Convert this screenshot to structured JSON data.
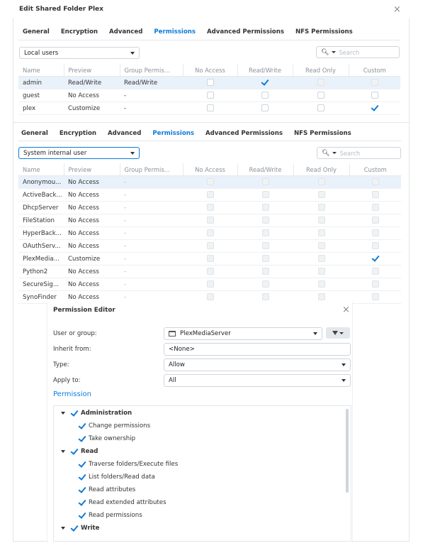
{
  "dialog_title": "Edit Shared Folder Plex",
  "tabs": [
    "General",
    "Encryption",
    "Advanced",
    "Permissions",
    "Advanced Permissions",
    "NFS Permissions"
  ],
  "panel1": {
    "user_filter": "Local users",
    "search_placeholder": "Search",
    "columns": [
      "Name",
      "Preview",
      "Group Permis...",
      "No Access",
      "Read/Write",
      "Read Only",
      "Custom"
    ],
    "rows": [
      {
        "name": "admin",
        "preview": "Read/Write",
        "group": "Read/Write"
      },
      {
        "name": "guest",
        "preview": "No Access",
        "group": "-"
      },
      {
        "name": "plex",
        "preview": "Customize",
        "group": "-"
      }
    ]
  },
  "panel2": {
    "user_filter": "System internal user",
    "search_placeholder": "Search",
    "columns": [
      "Name",
      "Preview",
      "Group Permis...",
      "No Access",
      "Read/Write",
      "Read Only",
      "Custom"
    ],
    "rows": [
      {
        "name": "Anonymou...",
        "preview": "No Access",
        "group": "-"
      },
      {
        "name": "ActiveBack...",
        "preview": "No Access",
        "group": "-"
      },
      {
        "name": "DhcpServer",
        "preview": "No Access",
        "group": "-"
      },
      {
        "name": "FileStation",
        "preview": "No Access",
        "group": "-"
      },
      {
        "name": "HyperBack...",
        "preview": "No Access",
        "group": "-"
      },
      {
        "name": "OAuthServ...",
        "preview": "No Access",
        "group": "-"
      },
      {
        "name": "PlexMedia...",
        "preview": "Customize",
        "group": "-"
      },
      {
        "name": "Python2",
        "preview": "No Access",
        "group": "-"
      },
      {
        "name": "SecureSig...",
        "preview": "No Access",
        "group": "-"
      },
      {
        "name": "SynoFinder",
        "preview": "No Access",
        "group": "-"
      }
    ]
  },
  "editor": {
    "title": "Permission Editor",
    "user_label": "User or group:",
    "user_value": "PlexMediaServer",
    "inherit_label": "Inherit from:",
    "inherit_value": "<None>",
    "type_label": "Type:",
    "type_value": "Allow",
    "apply_label": "Apply to:",
    "apply_value": "All",
    "permission_heading": "Permission",
    "tree": {
      "admin": "Administration",
      "admin_items": [
        "Change permissions",
        "Take ownership"
      ],
      "read": "Read",
      "read_items": [
        "Traverse folders/Execute files",
        "List folders/Read data",
        "Read attributes",
        "Read extended attributes",
        "Read permissions"
      ],
      "write": "Write"
    }
  },
  "colors": {
    "accent": "#0d7bd8",
    "danger": "#e03d3d",
    "warning": "#ef8b1c",
    "selected_row": "#e9f1fa"
  }
}
